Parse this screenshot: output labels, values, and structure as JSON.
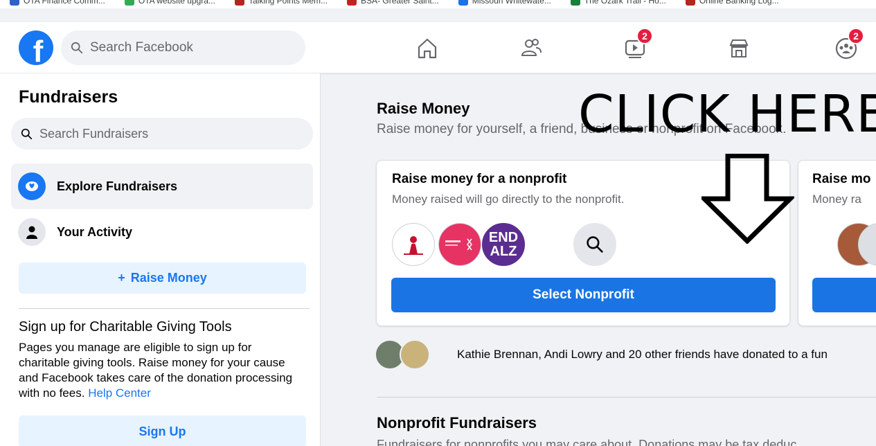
{
  "bookmarks": [
    {
      "label": "OTA Finance Comm...",
      "color": "#2e62c9"
    },
    {
      "label": "OTA website upgra...",
      "color": "#34a853"
    },
    {
      "label": "Talking Points Mem...",
      "color": "#b3261e"
    },
    {
      "label": "BSA- Greater Saint...",
      "color": "#c5221f"
    },
    {
      "label": "Missouri Whitewate...",
      "color": "#1a73e8"
    },
    {
      "label": "The Ozark Trail - Ho...",
      "color": "#188038"
    },
    {
      "label": "Online Banking Log...",
      "color": "#b3261e"
    }
  ],
  "topnav": {
    "logo": "f",
    "search_placeholder": "Search Facebook",
    "watch_badge": "2",
    "groups_badge": "2"
  },
  "sidebar": {
    "title": "Fundraisers",
    "search_placeholder": "Search Fundraisers",
    "items": [
      {
        "label": "Explore Fundraisers"
      },
      {
        "label": "Your Activity"
      }
    ],
    "raise_button": "Raise Money",
    "raise_button_plus": "+",
    "signup_heading": "Sign up for Charitable Giving Tools",
    "signup_text": "Pages you manage are eligible to sign up for charitable giving tools. Raise money for your cause and Facebook takes care of the donation processing with no fees.",
    "help_link": "Help Center",
    "signup_button": "Sign Up"
  },
  "main": {
    "title": "Raise Money",
    "subtitle": "Raise money for yourself, a friend, business or nonprofit on Facebook.",
    "card1": {
      "title": "Raise money for a nonprofit",
      "subtitle": "Money raised will go directly to the nonprofit.",
      "org3_text": "END ALZ",
      "button": "Select Nonprofit"
    },
    "card2": {
      "title": "Raise mo",
      "subtitle": "Money ra"
    },
    "donors_text": "Kathie Brennan, Andi Lowry and 20 other friends have donated to a fun",
    "section2_title": "Nonprofit Fundraisers",
    "section2_sub": "Fundraisers for nonprofits you may care about. Donations may be tax deduc"
  },
  "annotation": {
    "text": "CLICK HERE"
  },
  "colors": {
    "facebook_blue": "#1877f2",
    "button_blue": "#1b74e4",
    "badge_red": "#e41e3f",
    "light_blue_btn": "#e7f3ff"
  }
}
